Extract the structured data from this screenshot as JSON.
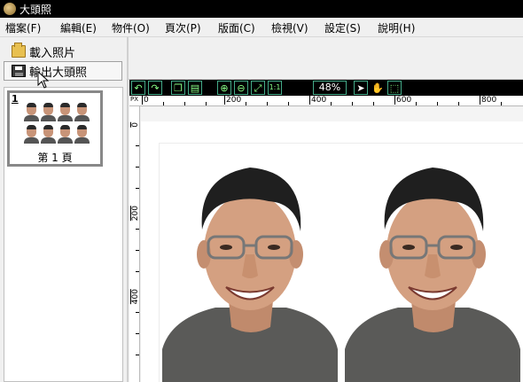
{
  "window": {
    "title": "大頭照"
  },
  "menu": [
    {
      "label": "檔案(F)"
    },
    {
      "label": "編輯(E)"
    },
    {
      "label": "物件(O)"
    },
    {
      "label": "頁次(P)"
    },
    {
      "label": "版面(C)"
    },
    {
      "label": "檢視(V)"
    },
    {
      "label": "設定(S)"
    },
    {
      "label": "說明(H)"
    }
  ],
  "left_panel": {
    "load_button": {
      "label": "載入照片",
      "icon": "folder-open-icon"
    },
    "export_button": {
      "label": "輸出大頭照",
      "icon": "floppy-disk-icon"
    },
    "pages": [
      {
        "number": "1",
        "label": "第 1 頁",
        "photo_count": 8
      }
    ]
  },
  "toolbar": {
    "zoom": "48%",
    "buttons": [
      "undo-icon",
      "redo-icon",
      "copy-icon",
      "paste-icon",
      "zoom-in-icon",
      "zoom-out-icon",
      "fit-page-icon",
      "actual-size-icon",
      "select-arrow-icon",
      "pan-hand-icon",
      "select-area-icon"
    ],
    "accent_color": "#44aa88"
  },
  "rulers": {
    "unit": "PX",
    "h_labels": [
      "0",
      "200",
      "400",
      "600",
      "800"
    ],
    "v_labels": [
      "0",
      "200",
      "400"
    ]
  },
  "canvas": {
    "photos_visible": 2,
    "background": "#ffffff"
  }
}
